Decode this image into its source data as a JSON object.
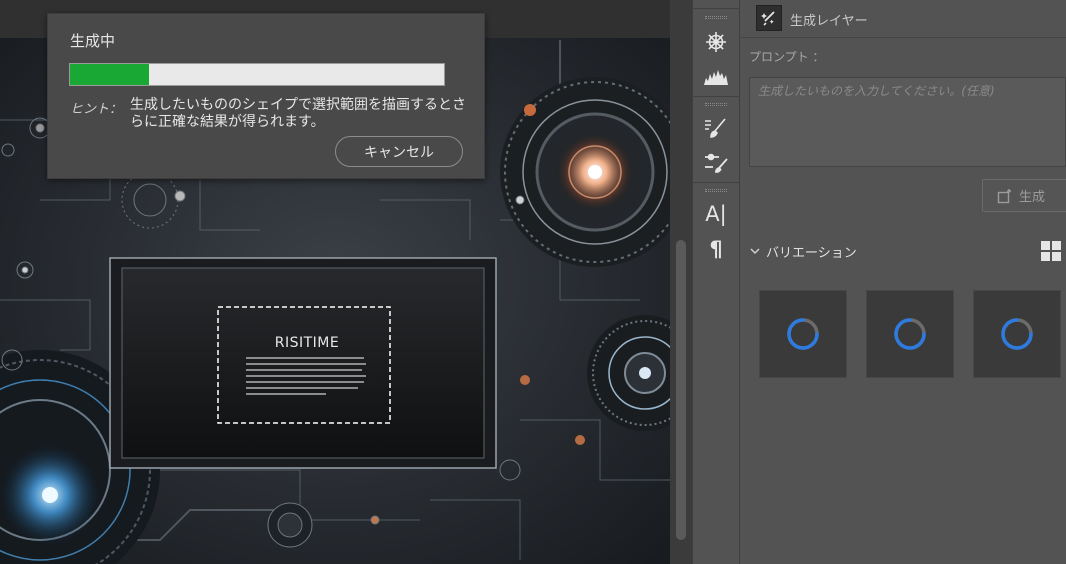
{
  "progress_dialog": {
    "title": "生成中",
    "progress": 0.21,
    "progress_color": "#19a833",
    "hint_label": "ヒント：",
    "hint_text": "生成したいもののシェイプで選択範囲を描画するとさらに正確な結果が得られます。",
    "cancel_label": "キャンセル"
  },
  "canvas": {
    "headline": "RISITIME"
  },
  "tool_strip": {
    "tools": [
      "ship-wheel-icon",
      "histogram-icon",
      "brush-list-icon",
      "adjust-brush-icon",
      "character-text-icon",
      "paragraph-icon"
    ],
    "character_glyph": "A|",
    "paragraph_glyph": "¶"
  },
  "panel": {
    "layer_name": "生成レイヤー",
    "prompt_label": "プロンプト ：",
    "prompt_value": "",
    "prompt_placeholder": "生成したいものを入力してください。(任意)",
    "generate_label": "生成",
    "variations_label": "バリエーション",
    "variation_count": 3,
    "accent_color": "#2d7be0"
  }
}
